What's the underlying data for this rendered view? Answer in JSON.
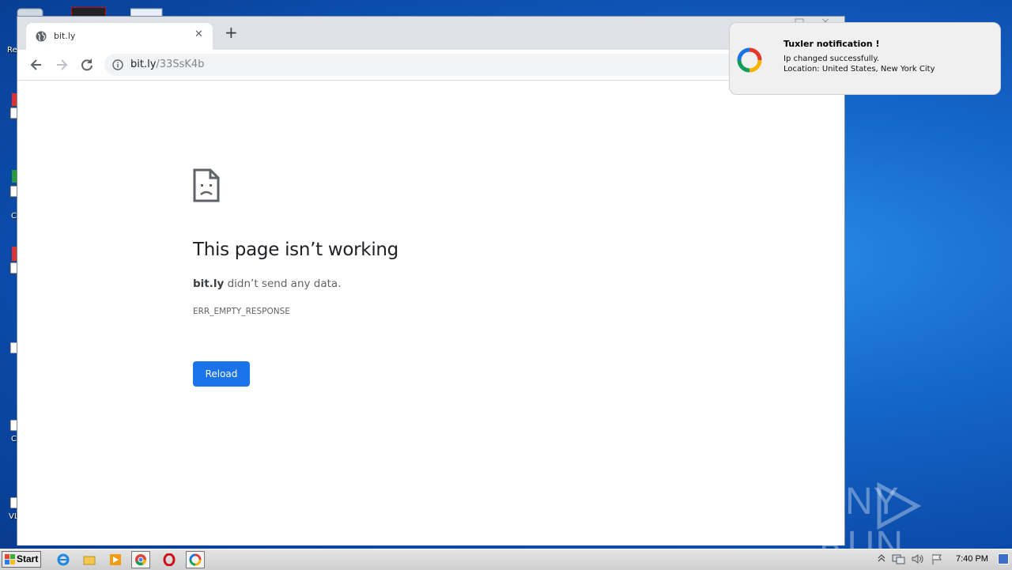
{
  "browser": {
    "tab": {
      "title": "bit.ly",
      "close": "✕"
    },
    "new_tab": "+",
    "address": {
      "host": "bit.ly",
      "path": "/33SsK4b"
    }
  },
  "error_page": {
    "title": "This page isn’t working",
    "host": "bit.ly",
    "description": " didn’t send any data.",
    "code": "ERR_EMPTY_RESPONSE",
    "reload_label": "Reload"
  },
  "notification": {
    "title": "Tuxler notification !",
    "line1": "Ip changed successfully.",
    "line2": "Location: United States, New York City"
  },
  "desktop": {
    "labels": [
      "Re",
      "C",
      "C",
      "VL"
    ]
  },
  "watermark": {
    "left": "ANY",
    "right": "RUN"
  },
  "taskbar": {
    "start_label": "Start",
    "clock": "7:40 PM"
  }
}
